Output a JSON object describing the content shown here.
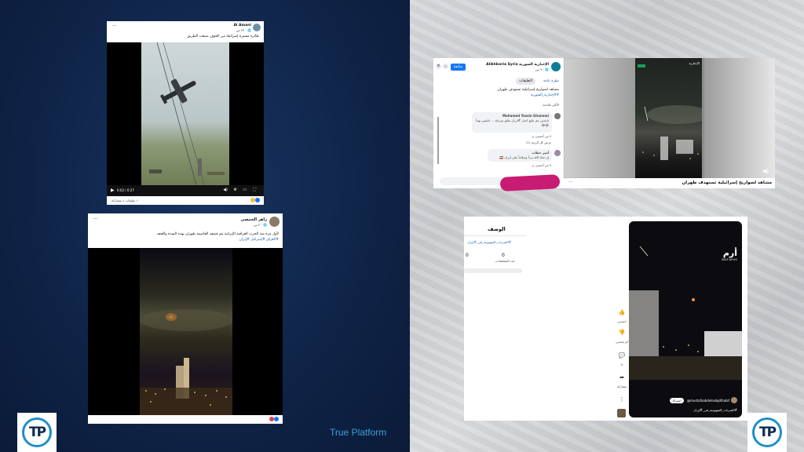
{
  "brand": {
    "name": "True Platform",
    "logo_text": "TP",
    "accent": "#3aa0d8"
  },
  "card1": {
    "author": "Al Amani",
    "time": "٢٣ س · 🌐",
    "post_text": "طائرة مسيرة إسرائيلة من الخوف ضيعت الطريق",
    "timecode": "0:02 / 0:27",
    "stats": "١٠ تعليقات  ٤ مشاركة"
  },
  "card2": {
    "author": "زاهر الحمصي",
    "time": "٣ س · 🌐",
    "post_text": "لأول مرة منذ الحرب العراقية الإيرانية يتم قصف العاصمة طهران بهذه الشدة والعنف",
    "hashtags": "#العراق #إسرائيل #إيران"
  },
  "card3": {
    "page_name": "Alikhbaria Syria الإخبارية السورية",
    "time": "٩ س · 🌐",
    "follow_label": "متابعة",
    "tab_overview": "نظرة عامة",
    "tab_comments": "التعليقات",
    "post_text": "مشاهد لصواريخ إسرائيلية تستهدف طهران",
    "hashtag": "#الإخبارية_السورية",
    "sort_label": "الأكثر ملاءمة",
    "comment1_author": "Mohamed Yassin Ghanemi",
    "comment1_text": "ناعدين عم نتابع اخبار #ايران نقلق ونرتاح ... خايفين تهدأ 😂😂",
    "comment1_meta": "٩ س  أعجبني  رد",
    "comment1_replies": "عرض كل الردود (1)",
    "comment2_author": "أمير خطاب",
    "comment2_text": "إن شاء الله برداً وسلاماً على إيران 🇮🇷",
    "comment2_meta": "٩ س  أعجبني  رد",
    "media_logo": "الإخبارية",
    "media_caption": "مشاهد لصواريخ إسرائيلية تستهدف طهران"
  },
  "card4": {
    "heading": "الوصف",
    "hashtag_line": "#الضربات_الصهيونية_في_#إيران",
    "stat1_value": "0",
    "stat1_label": "عدد المشاهدات",
    "stat2_value": "0",
    "stat2_label": "",
    "like_label": "أعجبني",
    "dislike_label": "لم يعجبني",
    "comment_count": "0",
    "share_label": "مشاركة",
    "channel_logo": "أرم",
    "channel_sub": "IRAM NEWS",
    "channel_handle": "@mustafaabdelnabyKhalaf",
    "subscribe_label": "اشتراك",
    "video_caption": "#الضربات_الصهيونية_في_#إيران"
  }
}
